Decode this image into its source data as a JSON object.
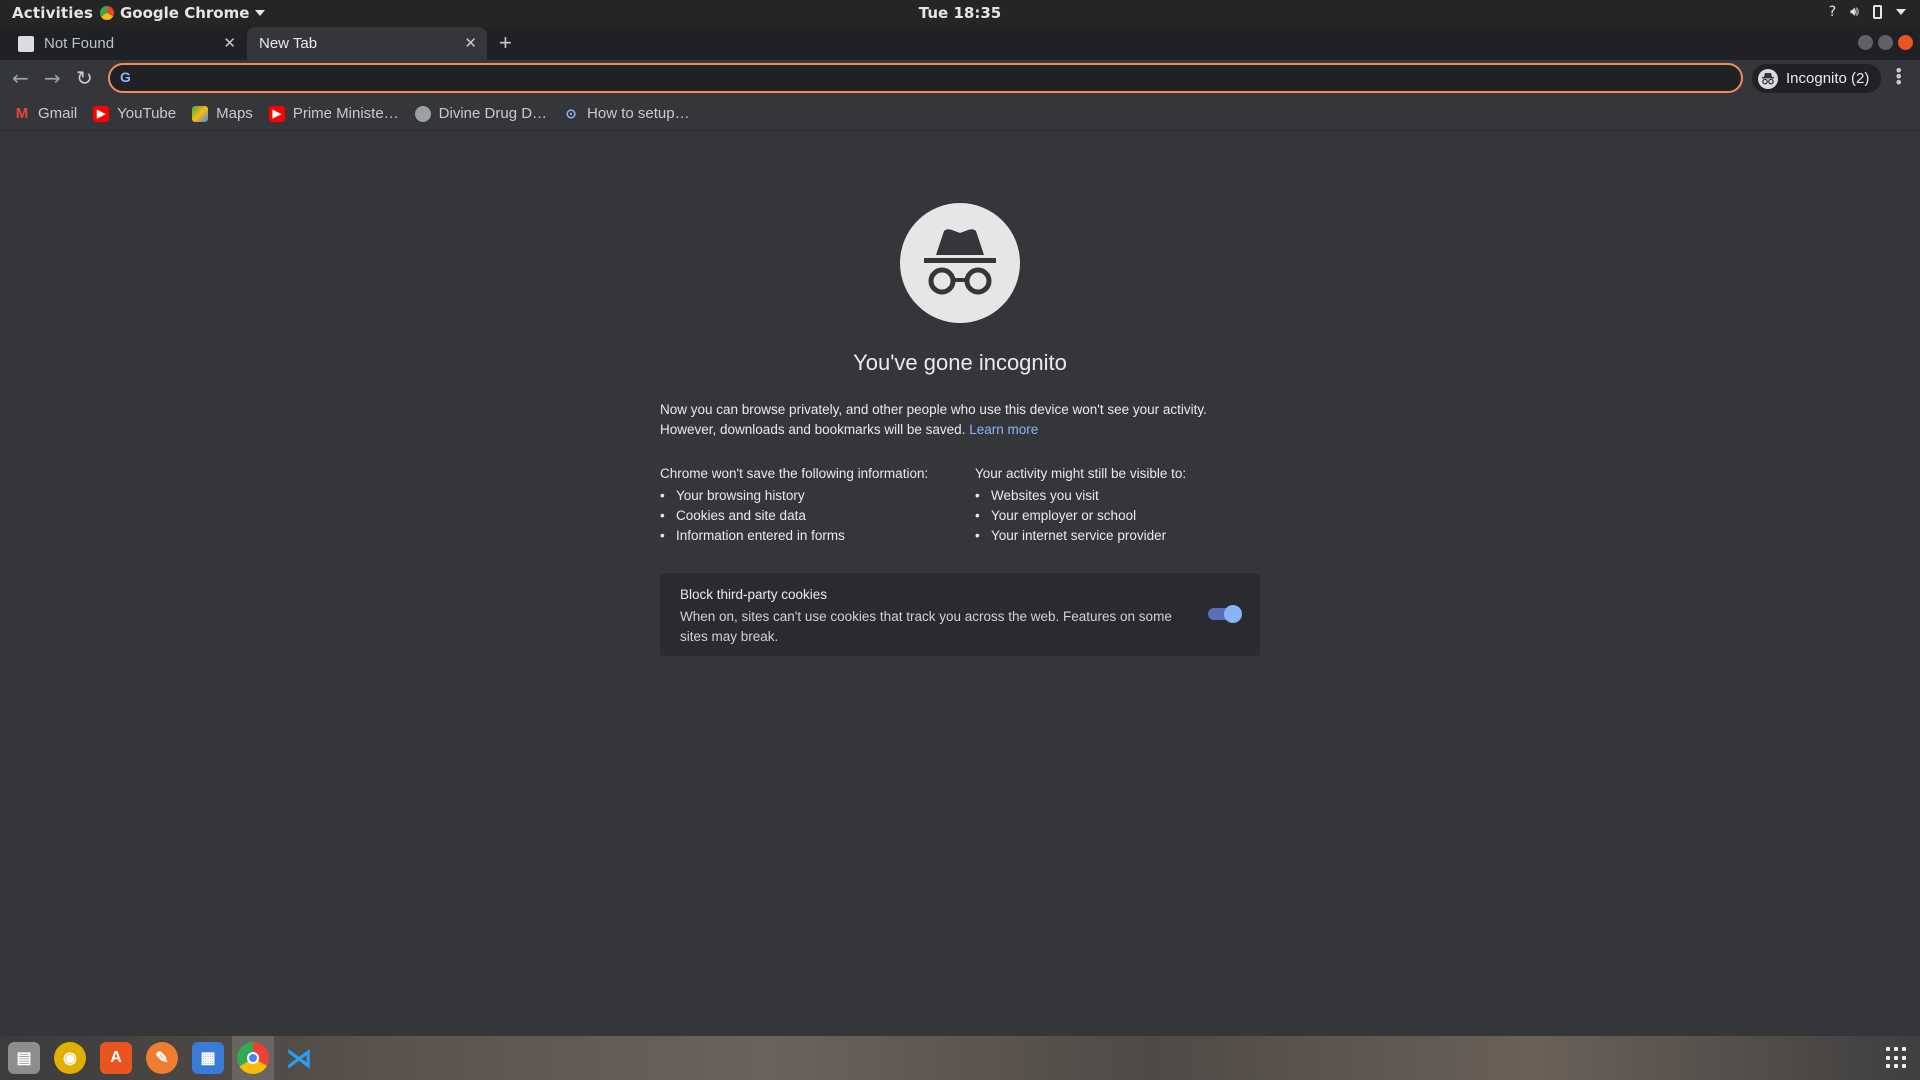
{
  "system": {
    "activities": "Activities",
    "app_name": "Google Chrome",
    "clock": "Tue 18:35",
    "tray_help": "?"
  },
  "tabs": [
    {
      "title": "Not Found",
      "active": false
    },
    {
      "title": "New Tab",
      "active": true
    }
  ],
  "toolbar": {
    "omnibox_value": "",
    "profile_label": "Incognito (2)"
  },
  "bookmarks": [
    {
      "label": "Gmail",
      "icon": "gmail-icon",
      "color": "#ea4335"
    },
    {
      "label": "YouTube",
      "icon": "youtube-icon",
      "color": "#ff0000"
    },
    {
      "label": "Maps",
      "icon": "maps-icon",
      "color": "#34a853"
    },
    {
      "label": "Prime Ministe…",
      "icon": "youtube-icon",
      "color": "#ff0000"
    },
    {
      "label": "Divine Drug D…",
      "icon": "globe-icon",
      "color": "#9aa0a6"
    },
    {
      "label": "How to setup…",
      "icon": "link-icon",
      "color": "#8ab4f8"
    }
  ],
  "incognito": {
    "headline": "You've gone incognito",
    "intro_line1": "Now you can browse privately, and other people who use this device won't see your activity.",
    "intro_line2": "However, downloads and bookmarks will be saved.",
    "learn_more": "Learn more",
    "not_saved_title": "Chrome won't save the following information:",
    "not_saved": [
      "Your browsing history",
      "Cookies and site data",
      "Information entered in forms"
    ],
    "visible_title": "Your activity might still be visible to:",
    "visible": [
      "Websites you visit",
      "Your employer or school",
      "Your internet service provider"
    ],
    "cookie_title": "Block third-party cookies",
    "cookie_desc": "When on, sites can't use cookies that track you across the web. Features on some sites may break.",
    "cookie_toggle_on": true
  },
  "dock": [
    {
      "name": "files-icon",
      "color": "#8d8d8d"
    },
    {
      "name": "rhythmbox-icon",
      "color": "#e0b000"
    },
    {
      "name": "software-center-icon",
      "color": "#e95420"
    },
    {
      "name": "brush-app-icon",
      "color": "#f07c32"
    },
    {
      "name": "document-viewer-icon",
      "color": "#3a7bd5"
    },
    {
      "name": "chrome-icon",
      "color": "#4285f4"
    },
    {
      "name": "vscode-icon",
      "color": "#0b6fcf"
    }
  ]
}
